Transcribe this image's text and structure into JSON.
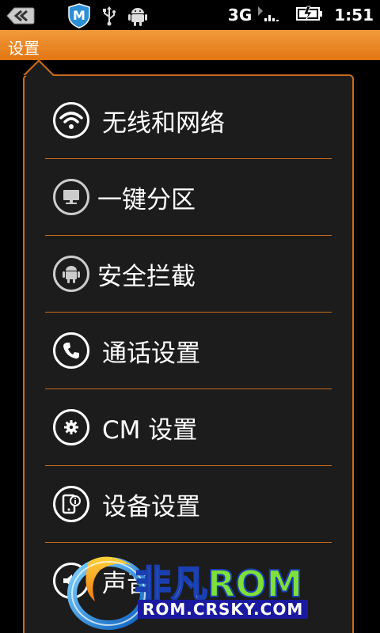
{
  "status_bar": {
    "network": "3G",
    "time": "1:51",
    "icons": [
      "back-icon",
      "m-shield-icon",
      "usb-icon",
      "android-debug-icon",
      "signal-icon",
      "battery-icon"
    ]
  },
  "title_bar": {
    "title": "设置"
  },
  "menu": {
    "items": [
      {
        "label": "无线和网络",
        "icon": "wifi-icon"
      },
      {
        "label": "一键分区",
        "icon": "monitor-icon"
      },
      {
        "label": "安全拦截",
        "icon": "android-icon"
      },
      {
        "label": "通话设置",
        "icon": "phone-icon"
      },
      {
        "label": "CM 设置",
        "icon": "gear-icon"
      },
      {
        "label": "设备设置",
        "icon": "device-info-icon"
      },
      {
        "label": "声音",
        "icon": "speaker-icon"
      }
    ]
  },
  "watermark": {
    "brand_cn": "非凡",
    "brand_en": "ROM",
    "url": "ROM.CRSKY.COM"
  },
  "colors": {
    "accent": "#e8841f",
    "divider": "#c96a1b",
    "panel_bg": "#1c1c1c"
  }
}
